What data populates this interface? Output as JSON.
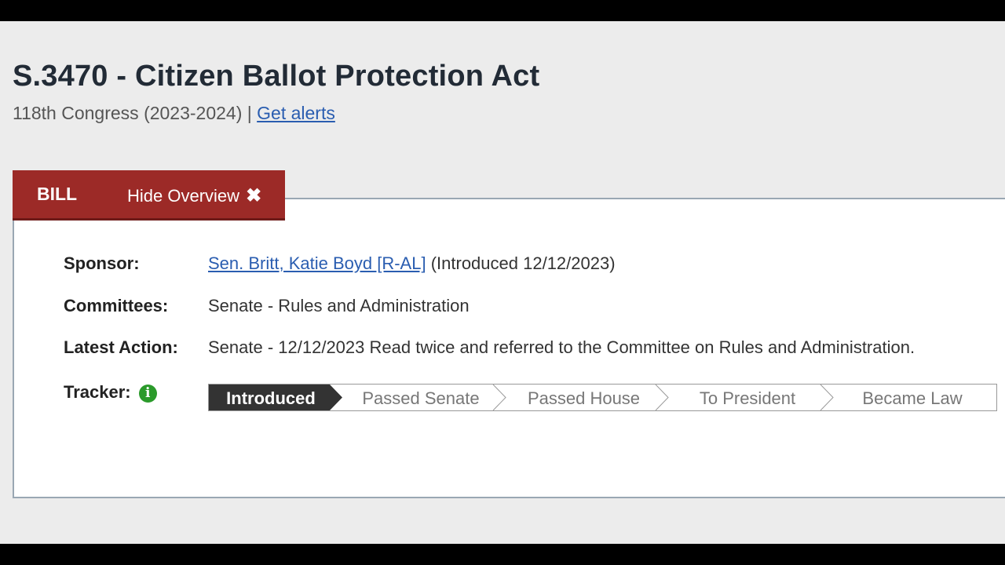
{
  "header": {
    "title": "S.3470 - Citizen Ballot Protection Act",
    "congress": "118th Congress (2023-2024) |",
    "alerts_link": "Get alerts"
  },
  "tabs": {
    "bill": "BILL",
    "hide_overview": "Hide Overview",
    "close_glyph": "✖"
  },
  "overview": {
    "sponsor_label": "Sponsor:",
    "sponsor_name": "Sen. Britt, Katie Boyd [R-AL]",
    "sponsor_note": "(Introduced 12/12/2023)",
    "committees_label": "Committees:",
    "committees_value": "Senate - Rules and Administration",
    "latest_action_label": "Latest Action:",
    "latest_action_value": "Senate - 12/12/2023 Read twice and referred to the Committee on Rules and Administration.",
    "tracker_label": "Tracker:",
    "info_icon": "info-icon"
  },
  "tracker": {
    "steps": [
      "Introduced",
      "Passed Senate",
      "Passed House",
      "To President",
      "Became Law"
    ],
    "current_step": "Introduced",
    "active_color": "#333333",
    "accent_color": "#2b9a2b"
  },
  "colors": {
    "tab_bg": "#9c2a27",
    "link": "#2a5db0"
  }
}
